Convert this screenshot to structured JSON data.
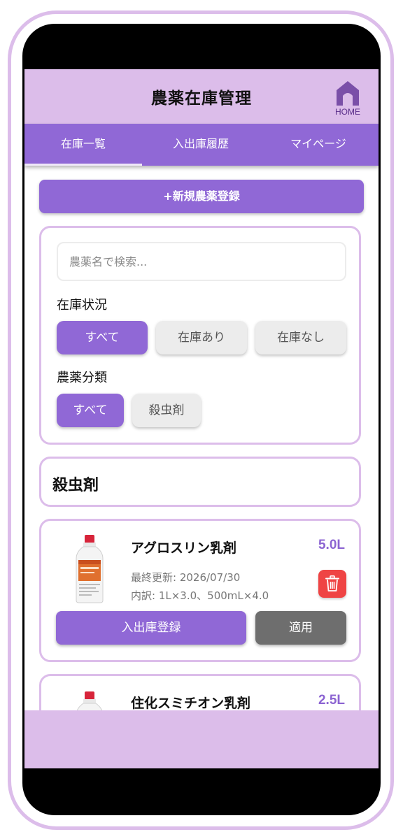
{
  "header": {
    "title": "農薬在庫管理",
    "home_label": "HOME"
  },
  "tabs": [
    {
      "label": "在庫一覧",
      "active": true
    },
    {
      "label": "入出庫履歴",
      "active": false
    },
    {
      "label": "マイページ",
      "active": false
    }
  ],
  "new_button_label": "+新規農薬登録",
  "filters": {
    "search_placeholder": "農薬名で検索...",
    "stock_label": "在庫状況",
    "stock_options": [
      {
        "label": "すべて",
        "selected": true
      },
      {
        "label": "在庫あり",
        "selected": false
      },
      {
        "label": "在庫なし",
        "selected": false
      }
    ],
    "category_label": "農薬分類",
    "category_options": [
      {
        "label": "すべて",
        "selected": true
      },
      {
        "label": "殺虫剤",
        "selected": false
      }
    ]
  },
  "category_title": "殺虫剤",
  "products": [
    {
      "name": "アグロスリン乳剤",
      "quantity": "5.0L",
      "updated": "最終更新: 2026/07/30",
      "breakdown": "内訳: 1L×3.0、500mL×4.0",
      "io_button": "入出庫登録",
      "apply_button": "適用",
      "icon": "trash-icon"
    },
    {
      "name": "住化スミチオン乳剤",
      "quantity": "2.5L"
    }
  ],
  "colors": {
    "primary": "#9068d6",
    "lavender": "#dcbdea",
    "danger": "#ef4444",
    "gray_button": "#6e6e6e"
  }
}
